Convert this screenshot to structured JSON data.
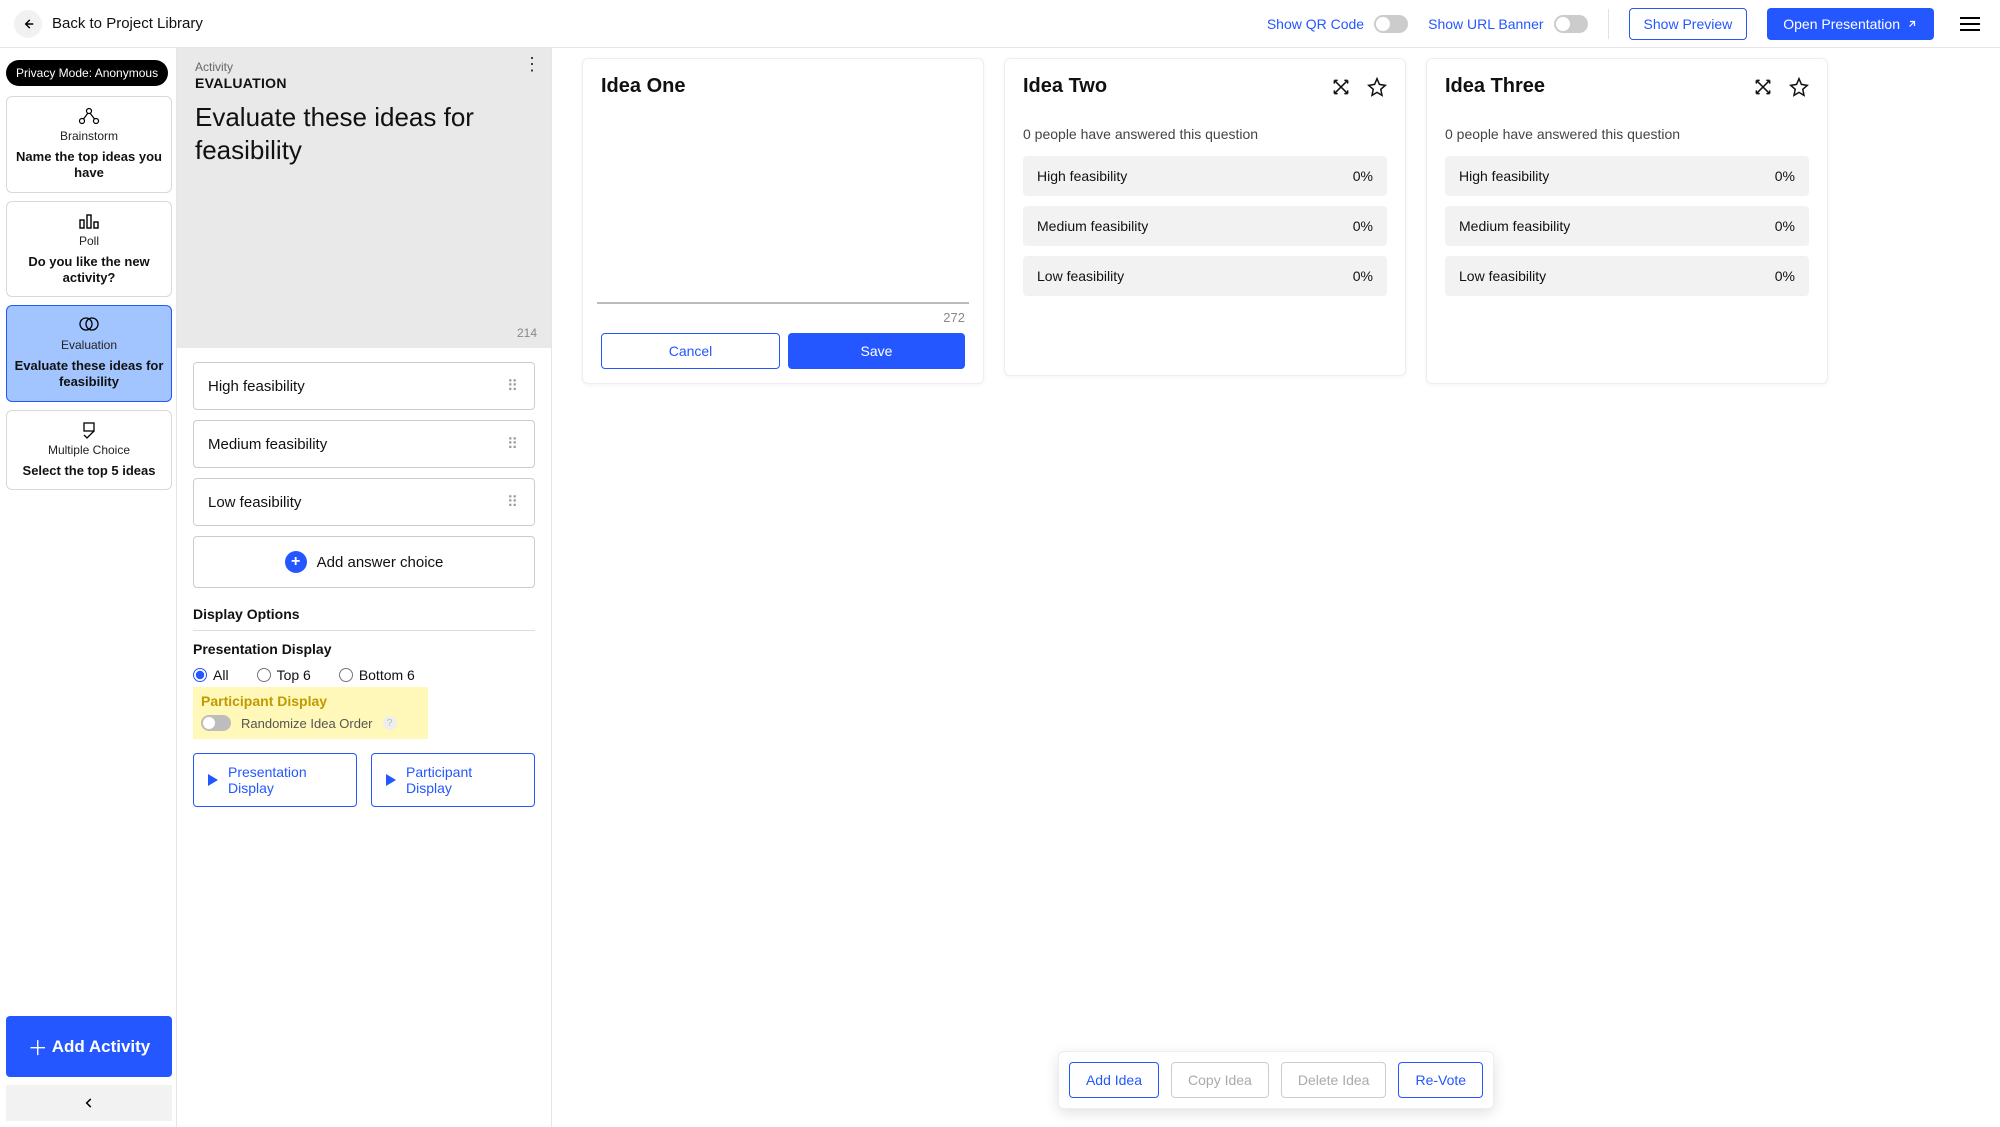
{
  "topbar": {
    "back_label": "Back to Project Library",
    "qr_label": "Show QR Code",
    "banner_label": "Show URL Banner",
    "preview_btn": "Show Preview",
    "open_btn": "Open Presentation"
  },
  "left": {
    "privacy_chip": "Privacy Mode: Anonymous",
    "activities": [
      {
        "kind": "Brainstorm",
        "title": "Name the top ideas you have"
      },
      {
        "kind": "Poll",
        "title": "Do you like the new activity?"
      },
      {
        "kind": "Evaluation",
        "title": "Evaluate these ideas for feasibility"
      },
      {
        "kind": "Multiple Choice",
        "title": "Select the top 5 ideas"
      }
    ],
    "add_activity": "Add Activity"
  },
  "mid": {
    "label_activity": "Activity",
    "label_eval": "EVALUATION",
    "prompt": "Evaluate these ideas for feasibility",
    "char_remaining": "214",
    "answers": [
      "High feasibility",
      "Medium feasibility",
      "Low feasibility"
    ],
    "add_answer": "Add answer choice",
    "display_options": "Display Options",
    "pres_display": "Presentation Display",
    "radio_all": "All",
    "radio_top6": "Top 6",
    "radio_bottom6": "Bottom 6",
    "participant_display": "Participant Display",
    "randomize": "Randomize Idea Order",
    "btn_pres": "Presentation Display",
    "btn_part": "Participant Display"
  },
  "ideas": {
    "one": {
      "title": "Idea One",
      "char_count": "272",
      "cancel": "Cancel",
      "save": "Save"
    },
    "two": {
      "title": "Idea Two",
      "answered": "0 people have answered this question",
      "rows": [
        {
          "label": "High feasibility",
          "pct": "0%"
        },
        {
          "label": "Medium feasibility",
          "pct": "0%"
        },
        {
          "label": "Low feasibility",
          "pct": "0%"
        }
      ]
    },
    "three": {
      "title": "Idea Three",
      "answered": "0 people have answered this question",
      "rows": [
        {
          "label": "High feasibility",
          "pct": "0%"
        },
        {
          "label": "Medium feasibility",
          "pct": "0%"
        },
        {
          "label": "Low feasibility",
          "pct": "0%"
        }
      ]
    }
  },
  "actions": {
    "add": "Add Idea",
    "copy": "Copy Idea",
    "delete": "Delete Idea",
    "revote": "Re-Vote"
  }
}
